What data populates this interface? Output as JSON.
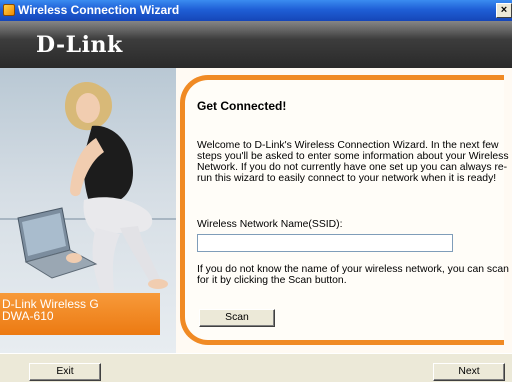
{
  "window": {
    "title": "Wireless Connection Wizard",
    "close_glyph": "×",
    "icon": "app-icon"
  },
  "brand": {
    "logo_text": "D-Link"
  },
  "sidebar": {
    "product_line1": "D-Link Wireless G",
    "product_line2": "DWA-610"
  },
  "main": {
    "title": "Get Connected!",
    "welcome_text": "Welcome to D-Link's Wireless Connection Wizard. In the next few steps you'll be asked to enter some information about your Wireless Network. If you do not currently have one set up you can always re-run this wizard to easily connect to your network when it is ready!",
    "ssid_label": "Wireless Network Name(SSID):",
    "ssid_value": "",
    "scan_note": "If you do not know the name of your wireless network, you can scan for it by clicking the Scan button.",
    "scan_label": "Scan"
  },
  "footer": {
    "exit_label": "Exit",
    "next_label": "Next"
  },
  "colors": {
    "accent": "#f08a24",
    "titlebar": "#1f5fd6",
    "brand_band": "#3c3c3c"
  }
}
